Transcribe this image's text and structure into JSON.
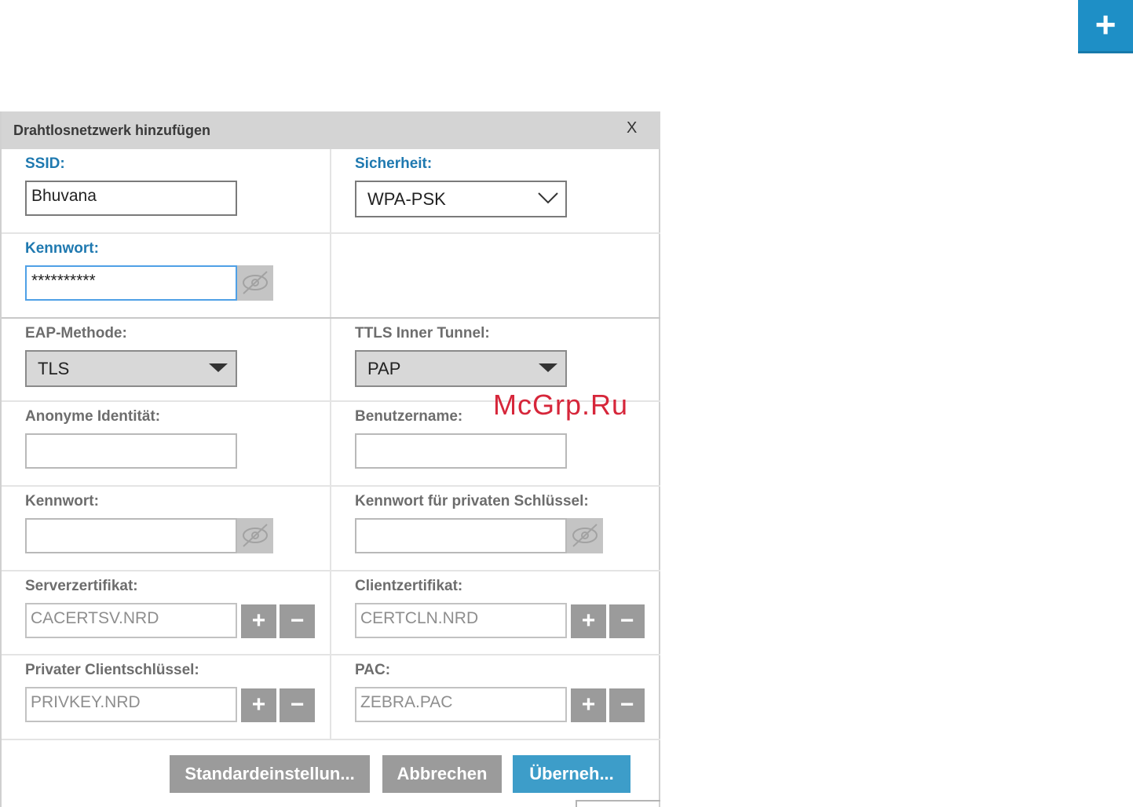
{
  "corner_button": {
    "label": "+"
  },
  "dialog": {
    "title": "Drahtlosnetzwerk hinzufügen",
    "close_label": "X",
    "ssid": {
      "label": "SSID:",
      "value": "Bhuvana"
    },
    "security": {
      "label": "Sicherheit:",
      "value": "WPA-PSK"
    },
    "password": {
      "label": "Kennwort:",
      "value": "**********"
    },
    "eap_method": {
      "label": "EAP-Methode:",
      "value": "TLS"
    },
    "ttls_inner": {
      "label": "TTLS Inner Tunnel:",
      "value": "PAP"
    },
    "anon_identity": {
      "label": "Anonyme Identität:",
      "value": ""
    },
    "username": {
      "label": "Benutzername:",
      "value": ""
    },
    "eap_password": {
      "label": "Kennwort:",
      "value": ""
    },
    "private_key_password": {
      "label": "Kennwort für privaten Schlüssel:",
      "value": ""
    },
    "server_cert": {
      "label": "Serverzertifikat:",
      "value": "CACERTSV.NRD"
    },
    "client_cert": {
      "label": "Clientzertifikat:",
      "value": "CERTCLN.NRD"
    },
    "private_client_key": {
      "label": "Privater Clientschlüssel:",
      "value": "PRIVKEY.NRD"
    },
    "pac": {
      "label": "PAC:",
      "value": "ZEBRA.PAC"
    },
    "plus_label": "+",
    "minus_label": "−",
    "buttons": {
      "defaults": "Standardeinstellun...",
      "cancel": "Abbrechen",
      "apply": "Überneh..."
    }
  },
  "watermark": "McGrp.Ru",
  "colors": {
    "accent": "#1e8fc6",
    "label_blue": "#1f79b0",
    "label_grey": "#6d6d6d",
    "button_grey": "#9b9b9b",
    "apply_button": "#3d9dc9"
  }
}
